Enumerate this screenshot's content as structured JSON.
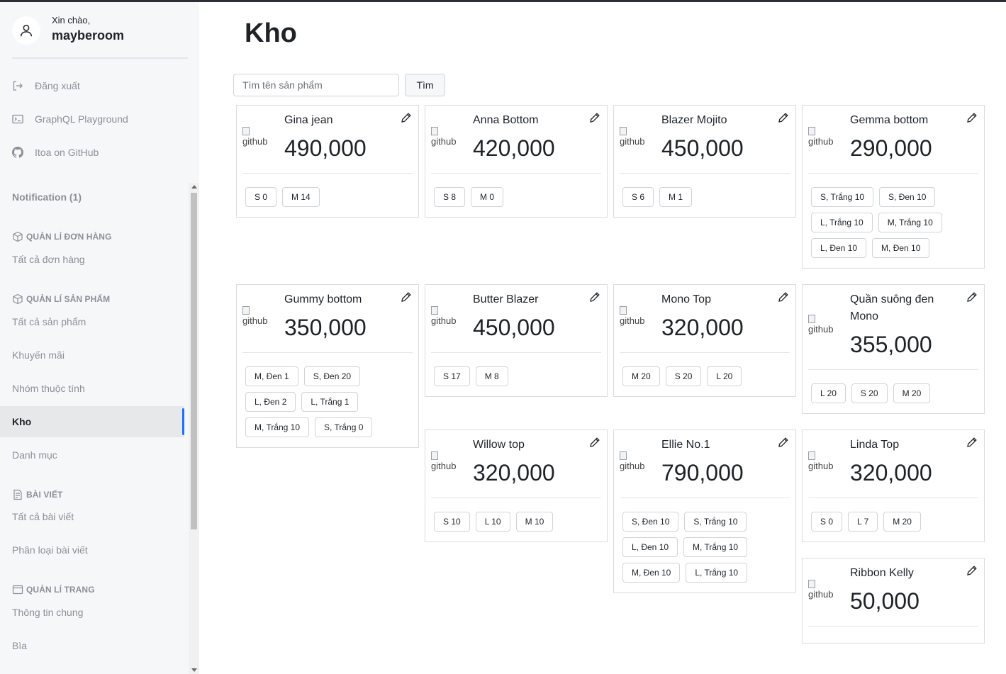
{
  "user": {
    "greeting": "Xin chào,",
    "name": "mayberoom"
  },
  "sidebar": {
    "links": [
      {
        "label": "Đăng xuất",
        "icon": "logout-icon"
      },
      {
        "label": "GraphQL Playground",
        "icon": "terminal-icon"
      },
      {
        "label": "Itoa on GitHub",
        "icon": "github-icon"
      }
    ],
    "notification": "Notification (1)",
    "sections": [
      {
        "title": "QUẢN LÍ ĐƠN HÀNG",
        "icon": "box-icon",
        "items": [
          "Tất cả đơn hàng"
        ]
      },
      {
        "title": "QUẢN LÍ SẢN PHẨM",
        "icon": "box-icon",
        "items": [
          "Tất cả sản phẩm",
          "Khuyến mãi",
          "Nhóm thuộc tính",
          "Kho",
          "Danh mục"
        ]
      },
      {
        "title": "BÀI VIẾT",
        "icon": "post-icon",
        "items": [
          "Tất cả bài viết",
          "Phân loại bài viết"
        ]
      },
      {
        "title": "QUẢN LÍ TRANG",
        "icon": "window-icon",
        "items": [
          "Thông tin chung",
          "Bìa"
        ]
      }
    ],
    "active_item": "Kho"
  },
  "main": {
    "title": "Kho",
    "search": {
      "placeholder": "Tìm tên sản phẩm",
      "button": "Tìm"
    },
    "image_alt": "github",
    "products": [
      {
        "name": "Gina jean",
        "price": "490,000",
        "stock": [
          "S 0",
          "M 14"
        ]
      },
      {
        "name": "Anna Bottom",
        "price": "420,000",
        "stock": [
          "S 8",
          "M 0"
        ]
      },
      {
        "name": "Blazer Mojito",
        "price": "450,000",
        "stock": [
          "S 6",
          "M 1"
        ]
      },
      {
        "name": "Gemma bottom",
        "price": "290,000",
        "stock": [
          "S, Trắng 10",
          "S, Đen 10",
          "L, Trắng 10",
          "M, Trắng 10",
          "L, Đen 10",
          "M, Đen 10"
        ]
      },
      {
        "name": "Gummy bottom",
        "price": "350,000",
        "stock": [
          "M, Đen 1",
          "S, Đen 20",
          "L, Đen 2",
          "L, Trắng 1",
          "M, Trắng 10",
          "S, Trắng 0"
        ]
      },
      {
        "name": "Butter Blazer",
        "price": "450,000",
        "stock": [
          "S 17",
          "M 8"
        ]
      },
      {
        "name": "Mono Top",
        "price": "320,000",
        "stock": [
          "M 20",
          "S 20",
          "L 20"
        ]
      },
      {
        "name": "Quần suông đen Mono",
        "price": "355,000",
        "stock": [
          "L 20",
          "S 20",
          "M 20"
        ]
      },
      {
        "name": "Willow top",
        "price": "320,000",
        "stock": [
          "S 10",
          "L 10",
          "M 10"
        ]
      },
      {
        "name": "Ellie No.1",
        "price": "790,000",
        "stock": [
          "S, Đen 10",
          "S, Trắng 10",
          "L, Đen 10",
          "M, Trắng 10",
          "M, Đen 10",
          "L, Trắng 10"
        ]
      },
      {
        "name": "Linda Top",
        "price": "320,000",
        "stock": [
          "S 0",
          "L 7",
          "M 20"
        ]
      },
      {
        "name": "Ribbon Kelly",
        "price": "50,000",
        "stock": []
      }
    ]
  }
}
